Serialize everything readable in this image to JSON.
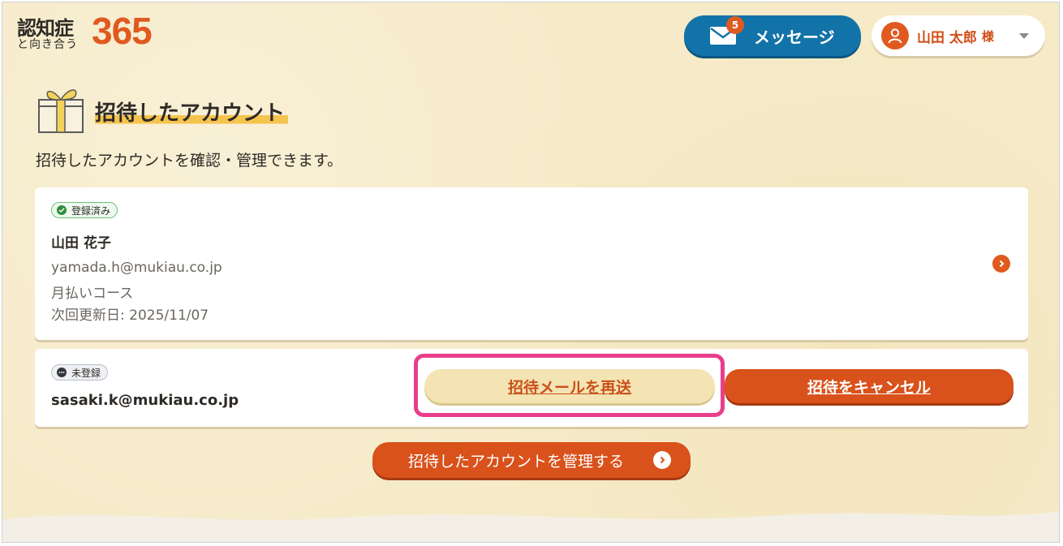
{
  "header": {
    "logo_main": "認知症",
    "logo_sub": "と向き合う",
    "logo_number": "365",
    "messages_label": "メッセージ",
    "messages_badge": "5",
    "user_name": "山田 太郎",
    "user_honorific": "様"
  },
  "page": {
    "title": "招待したアカウント",
    "description": "招待したアカウントを確認・管理できます。"
  },
  "accounts": [
    {
      "status": "登録済み",
      "name": "山田 花子",
      "email": "yamada.h@mukiau.co.jp",
      "plan": "月払いコース",
      "renewal": "次回更新日: 2025/11/07"
    },
    {
      "status": "未登録",
      "email": "sasaki.k@mukiau.co.jp",
      "resend_label": "招待メールを再送",
      "cancel_label": "招待をキャンセル"
    }
  ],
  "manage_button_label": "招待したアカウントを管理する",
  "colors": {
    "background": "#f6ebc9",
    "accent_orange": "#e05a1f",
    "message_blue": "#1273a8",
    "highlight_pink": "#e83e8c",
    "title_underline": "#f5c44e"
  },
  "icons": [
    "envelope-icon",
    "user-icon",
    "caret-down-icon",
    "gift-icon",
    "check-circle-icon",
    "ellipsis-circle-icon",
    "chevron-right-icon"
  ]
}
